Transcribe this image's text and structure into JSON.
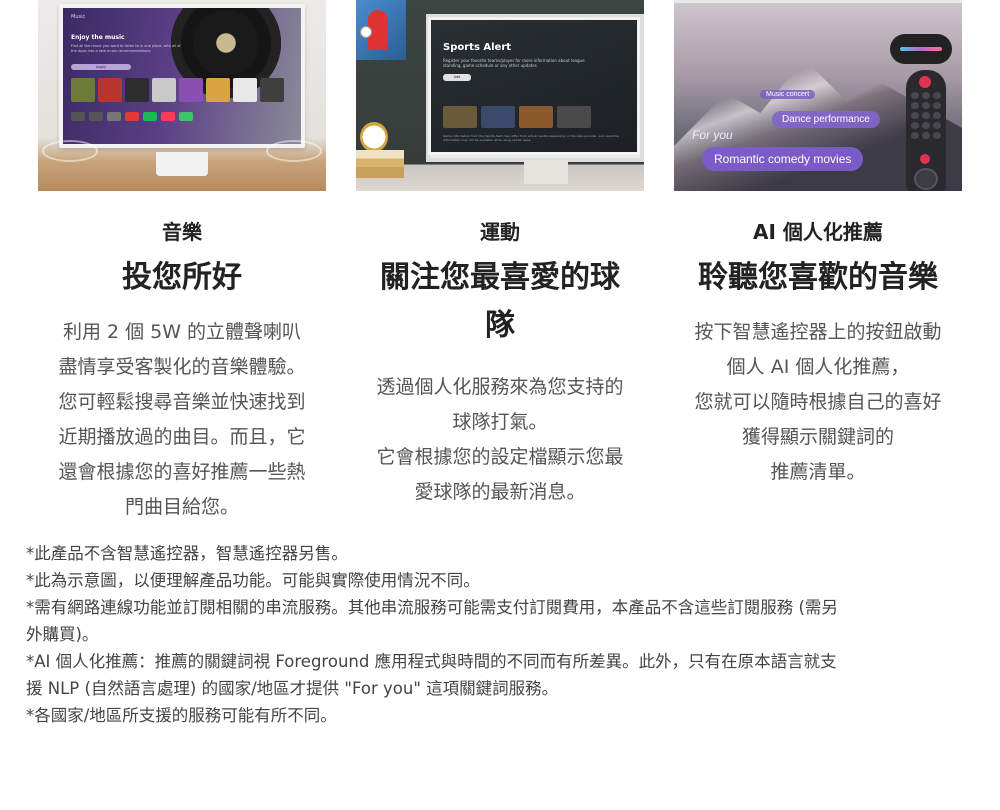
{
  "features": [
    {
      "category": "音樂",
      "headline": "投您所好",
      "body_lines": [
        "利用 2 個 5W 的立體聲喇叭",
        "盡情享受客製化的音樂體驗。",
        "您可輕鬆搜尋音樂並快速找到",
        "近期播放過的曲目。而且，它",
        "還會根據您的喜好推薦一些熱",
        "門曲目給您。"
      ],
      "image": {
        "app_label": "Music",
        "heading": "Enjoy the music",
        "subtitle": "Find all the music you want to listen to in one place, with all of the Apps into a new music recommendations.",
        "pill": "Apply"
      }
    },
    {
      "category": "運動",
      "headline_lines": [
        "關注您最喜愛的球",
        "隊"
      ],
      "body_lines": [
        "透過個人化服務來為您支持的",
        "球隊打氣。",
        "它會根據您的設定檔顯示您最",
        "愛球隊的最新消息。"
      ],
      "image": {
        "title": "Sports Alert",
        "subtitle": "Register your favorite teams/player for more information about league standing, game schedule or any other updates",
        "button": "Add",
        "footer": "Game information from the Sports Alert may differ from actual results depending on the data provider, and real-time information may not be available while using certain apps."
      }
    },
    {
      "category": "AI 個人化推薦",
      "headline": "聆聽您喜歡的音樂",
      "body_lines": [
        "按下智慧遙控器上的按鈕啟動",
        "個人 AI 個人化推薦，",
        "您就可以隨時根據自己的喜好",
        "獲得顯示關鍵詞的",
        "推薦清單。"
      ],
      "image": {
        "pill_small": "Music concert",
        "pill_medium": "Dance performance",
        "for_you": "For you",
        "pill_large": "Romantic comedy movies"
      }
    }
  ],
  "notes": [
    "*此產品不含智慧遙控器，智慧遙控器另售。",
    "*此為示意圖，以便理解產品功能。可能與實際使用情況不同。",
    "*需有網路連線功能並訂閱相關的串流服務。其他串流服務可能需支付訂閱費用，本產品不含這些訂閱服務 (需另",
    "外購買)。",
    "*AI 個人化推薦：推薦的關鍵詞視 Foreground 應用程式與時間的不同而有所差異。此外，只有在原本語言就支",
    "援 NLP (自然語言處理) 的國家/地區才提供 \"For you\" 這項關鍵詞服務。",
    "*各國家/地區所支援的服務可能有所不同。"
  ]
}
